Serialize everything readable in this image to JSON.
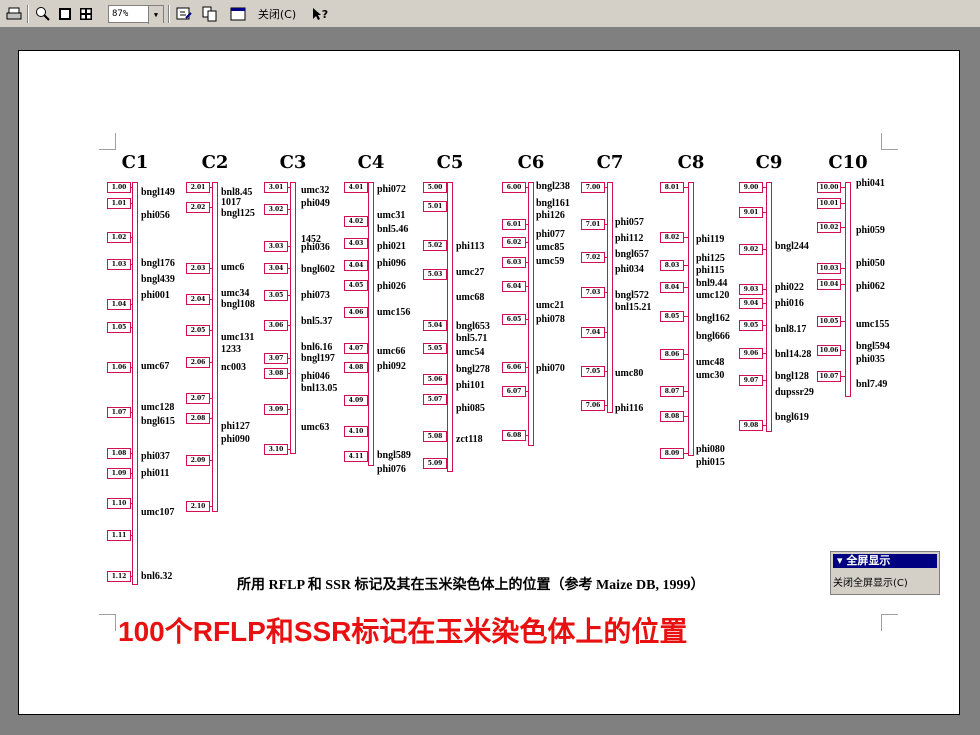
{
  "toolbar": {
    "zoom_value": "87%",
    "close_label": "关闭(C)",
    "help_label": "?"
  },
  "chromosomes": [
    {
      "name": "C1",
      "positions": [
        "1.00",
        "1.01",
        "1.02",
        "1.03",
        "1.04",
        "1.05",
        "1.06",
        "1.07",
        "1.08",
        "1.09",
        "1.10",
        "1.11",
        "1.12"
      ],
      "markers": [
        "bngl149",
        "phi056",
        "bngl176",
        "bngl439",
        "phi001",
        "umc67",
        "umc128",
        "bngl615",
        "phi037",
        "phi011",
        "umc107",
        "bnl6.32"
      ]
    },
    {
      "name": "C2",
      "positions": [
        "2.01",
        "2.02",
        "2.03",
        "2.04",
        "2.05",
        "2.06",
        "2.07",
        "2.08",
        "2.09",
        "2.10"
      ],
      "markers": [
        "bnl8.45",
        "1017",
        "bngl125",
        "umc6",
        "umc34",
        "bngl108",
        "umc131",
        "1233",
        "nc003",
        "phi127",
        "phi090"
      ]
    },
    {
      "name": "C3",
      "positions": [
        "3.01",
        "3.02",
        "3.03",
        "3.04",
        "3.05",
        "3.06",
        "3.07",
        "3.08",
        "3.09",
        "3.10"
      ],
      "markers": [
        "umc32",
        "phi049",
        "1452",
        "phi036",
        "bngl602",
        "phi073",
        "bnl5.37",
        "bnl6.16",
        "bngl197",
        "phi046",
        "bnl13.05",
        "umc63"
      ]
    },
    {
      "name": "C4",
      "positions": [
        "4.01",
        "4.02",
        "4.03",
        "4.04",
        "4.05",
        "4.06",
        "4.07",
        "4.08",
        "4.09",
        "4.10",
        "4.11"
      ],
      "markers": [
        "phi072",
        "umc31",
        "bnl5.46",
        "phi021",
        "phi096",
        "phi026",
        "umc156",
        "umc66",
        "phi092",
        "bngl589",
        "phi076"
      ]
    },
    {
      "name": "C5",
      "positions": [
        "5.00",
        "5.01",
        "5.02",
        "5.03",
        "5.04",
        "5.05",
        "5.06",
        "5.07",
        "5.08",
        "5.09"
      ],
      "markers": [
        "phi113",
        "umc27",
        "umc68",
        "bngl653",
        "bnl5.71",
        "umc54",
        "bngl278",
        "phi101",
        "phi085",
        "zct118"
      ]
    },
    {
      "name": "C6",
      "positions": [
        "6.00",
        "6.01",
        "6.02",
        "6.03",
        "6.04",
        "6.05",
        "6.06",
        "6.07",
        "6.08"
      ],
      "markers": [
        "bngl238",
        "bngl161",
        "phi126",
        "phi077",
        "umc85",
        "umc59",
        "umc21",
        "phi078",
        "phi070"
      ]
    },
    {
      "name": "C7",
      "positions": [
        "7.00",
        "7.01",
        "7.02",
        "7.03",
        "7.04",
        "7.05",
        "7.06"
      ],
      "markers": [
        "phi057",
        "phi112",
        "bngl657",
        "phi034",
        "bngl572",
        "bnl15.21",
        "umc80",
        "phi116"
      ]
    },
    {
      "name": "C8",
      "positions": [
        "8.01",
        "8.02",
        "8.03",
        "8.04",
        "8.05",
        "8.06",
        "8.07",
        "8.08",
        "8.09"
      ],
      "markers": [
        "phi119",
        "phi125",
        "phi115",
        "bnl9.44",
        "umc120",
        "bngl162",
        "bngl666",
        "umc48",
        "umc30",
        "phi080",
        "phi015"
      ]
    },
    {
      "name": "C9",
      "positions": [
        "9.00",
        "9.01",
        "9.02",
        "9.03",
        "9.04",
        "9.05",
        "9.06",
        "9.07",
        "9.08"
      ],
      "markers": [
        "bngl244",
        "phi022",
        "phi016",
        "bnl8.17",
        "bnl14.28",
        "bngl128",
        "dupssr29",
        "bngl619"
      ]
    },
    {
      "name": "C10",
      "positions": [
        "10.00",
        "10.01",
        "10.02",
        "10.03",
        "10.04",
        "10.05",
        "10.06",
        "10.07"
      ],
      "markers": [
        "phi041",
        "phi059",
        "phi050",
        "phi062",
        "umc155",
        "bngl594",
        "phi035",
        "bnl7.49"
      ]
    }
  ],
  "caption": "所用 RFLP 和 SSR 标记及其在玉米染色体上的位置（参考 Maize DB, 1999）",
  "title": "100个RFLP和SSR标记在玉米染色体上的位置",
  "fullscreen_menu": {
    "header": "▾ 全屏显示",
    "item": "关闭全屏显示(C)"
  },
  "colors": {
    "title": "#e81010",
    "map_line": "#d01050",
    "menu_header": "#000080"
  }
}
